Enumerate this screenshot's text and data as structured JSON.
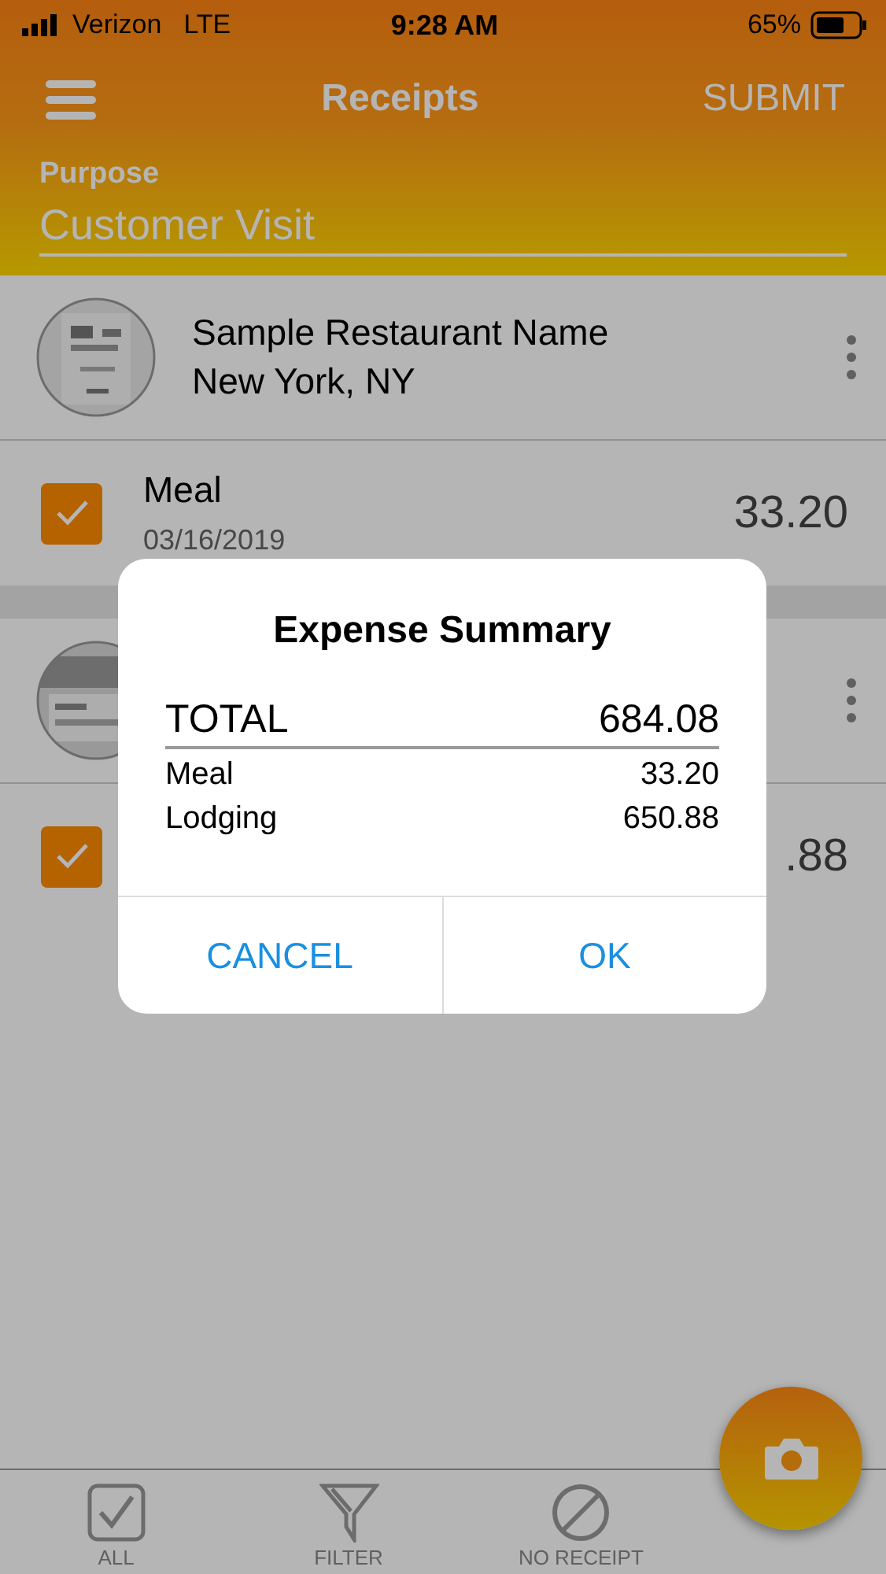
{
  "status_bar": {
    "carrier": "Verizon",
    "network": "LTE",
    "time": "9:28 AM",
    "battery": "65%"
  },
  "nav": {
    "title": "Receipts",
    "action": "SUBMIT"
  },
  "purpose": {
    "label": "Purpose",
    "value": "Customer Visit"
  },
  "receipts": [
    {
      "merchant": "Sample Restaurant Name",
      "location": "New York, NY",
      "expenses": [
        {
          "category": "Meal",
          "date": "03/16/2019",
          "amount": "33.20",
          "checked": true
        }
      ]
    },
    {
      "expenses": [
        {
          "amount": ".88",
          "checked": true
        }
      ]
    }
  ],
  "toolbar": [
    {
      "label": "ALL",
      "kind": "all"
    },
    {
      "label": "FILTER",
      "kind": "filter"
    },
    {
      "label": "NO RECEIPT",
      "kind": "none"
    }
  ],
  "dialog": {
    "title": "Expense Summary",
    "total_label": "TOTAL",
    "total": "684.08",
    "lines": [
      {
        "label": "Meal",
        "amount": "33.20"
      },
      {
        "label": "Lodging",
        "amount": "650.88"
      }
    ],
    "buttons": [
      "CANCEL",
      "OK"
    ]
  }
}
